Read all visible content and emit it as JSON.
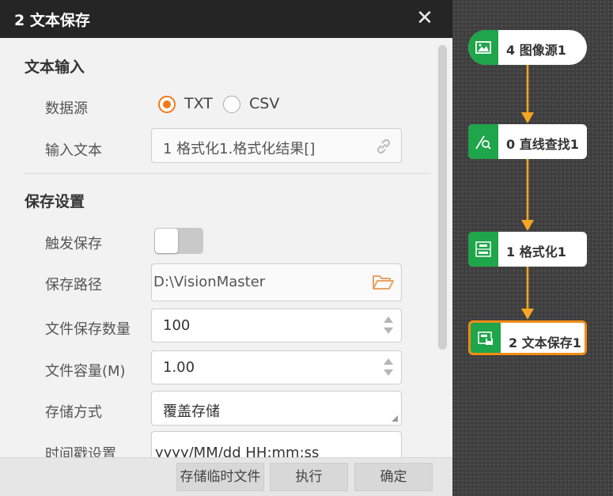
{
  "dialog": {
    "title": "2 文本保存",
    "close_glyph": "✕"
  },
  "text_input": {
    "section_title": "文本输入",
    "data_source_label": "数据源",
    "data_source_options": [
      "TXT",
      "CSV"
    ],
    "data_source_selected": "TXT",
    "input_text_label": "输入文本",
    "input_text_value": "1 格式化1.格式化结果[]",
    "input_text_icon": "link-icon"
  },
  "save_settings": {
    "section_title": "保存设置",
    "trigger_save_label": "触发保存",
    "trigger_save_on": false,
    "save_path_label": "保存路径",
    "save_path_value": "D:\\VisionMaster",
    "save_path_icon": "folder-open-icon",
    "file_count_label": "文件保存数量",
    "file_count_value": "100",
    "file_capacity_label": "文件容量(M)",
    "file_capacity_value": "1.00",
    "storage_mode_label": "存储方式",
    "storage_mode_value": "覆盖存储",
    "timestamp_label": "时间戳设置",
    "timestamp_value": "yyyy/MM/dd HH:mm:ss"
  },
  "footer": {
    "save_temp_label": "存储临时文件",
    "execute_label": "执行",
    "confirm_label": "确定"
  },
  "flow": {
    "nodes": [
      {
        "label": "4 图像源1",
        "icon": "image-icon"
      },
      {
        "label": "0 直线查找1",
        "icon": "line-find-icon"
      },
      {
        "label": "1 格式化1",
        "icon": "format-icon"
      },
      {
        "label": "2 文本保存1",
        "icon": "text-save-icon",
        "selected": true
      }
    ],
    "connector_color": "#f5a623"
  },
  "colors": {
    "accent": "#f07a18",
    "node_icon_bg": "#1fa54a",
    "titlebar_bg": "#252526",
    "canvas_bg": "#3e3e3e"
  }
}
